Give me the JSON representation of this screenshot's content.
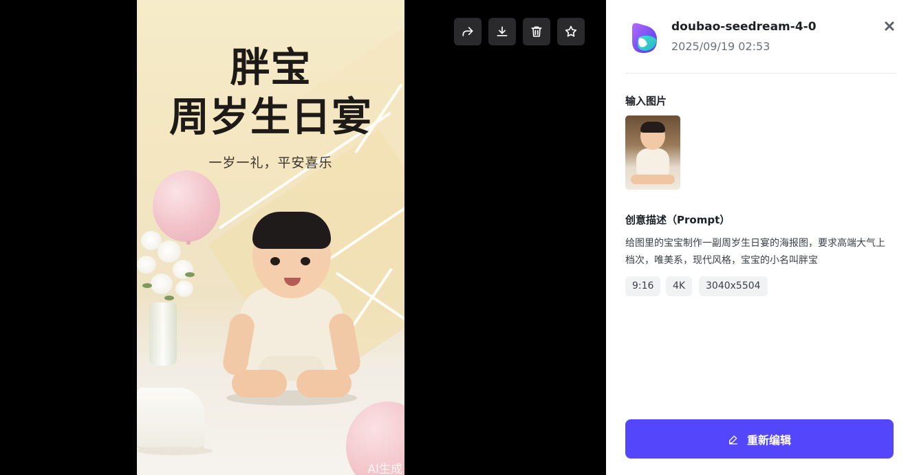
{
  "colors": {
    "accent": "#5447fb",
    "viewer_background": "#000000",
    "panel_background": "#ffffff",
    "toolbar_button": "#2a2a2c",
    "chip_background": "#f1f2f4"
  },
  "poster": {
    "title_line1": "胖宝",
    "title_line2": "周岁生日宴",
    "subtitle": "一岁一礼，平安喜乐",
    "ai_watermark": "AI生成"
  },
  "toolbar": {
    "buttons": [
      {
        "name": "share",
        "icon": "share-icon"
      },
      {
        "name": "download",
        "icon": "download-icon"
      },
      {
        "name": "delete",
        "icon": "trash-icon"
      },
      {
        "name": "favorite",
        "icon": "star-icon"
      }
    ]
  },
  "details": {
    "model_name": "doubao-seedream-4-0",
    "created_at": "2025/09/19 02:53",
    "close_icon": "close-icon",
    "input_images_label": "输入图片",
    "prompt_label": "创意描述（Prompt）",
    "prompt_text": "给图里的宝宝制作一副周岁生日宴的海报图，要求高端大气上档次，唯美系，现代风格，宝宝的小名叫胖宝",
    "chips": [
      "9:16",
      "4K",
      "3040x5504"
    ],
    "reedit_label": "重新编辑",
    "reedit_icon": "pencil-icon"
  }
}
